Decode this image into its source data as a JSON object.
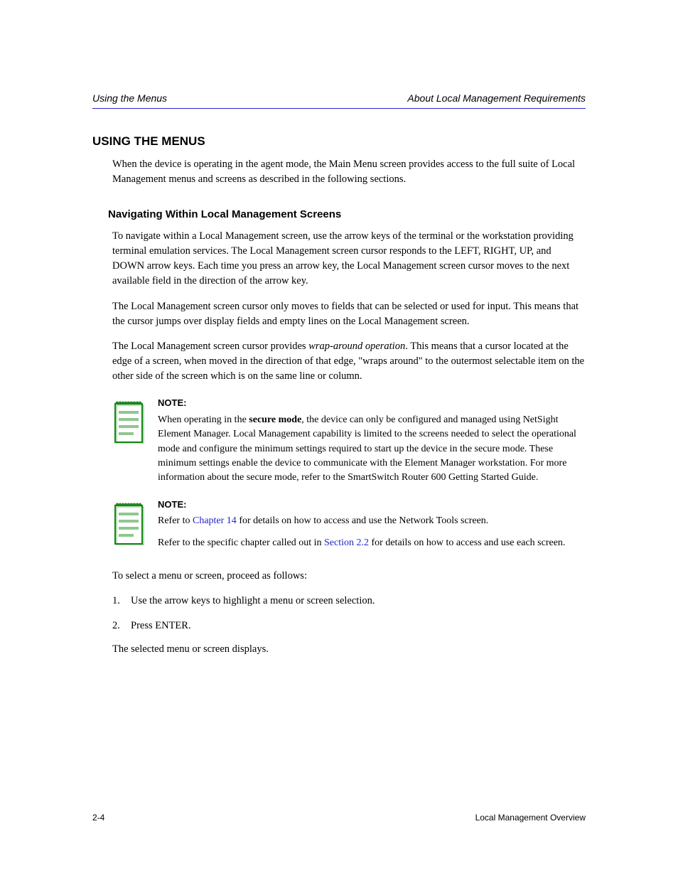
{
  "header": {
    "left": "Using the Menus",
    "right": "About Local Management Requirements"
  },
  "section_title": "USING THE MENUS",
  "intro_para": "When the device is operating in the agent mode, the Main Menu screen provides access to the full suite of Local Management menus and screens as described in the following sections.",
  "subsection_title": "Navigating Within Local Management Screens",
  "body1": "To navigate within a Local Management screen, use the arrow keys of the terminal or the workstation providing terminal emulation services. The Local Management screen cursor responds to the LEFT, RIGHT, UP, and DOWN arrow keys. Each time you press an arrow key, the Local Management screen cursor moves to the next available field in the direction of the arrow key.",
  "body2": "The Local Management screen cursor only moves to fields that can be selected or used for input. This means that the cursor jumps over display fields and empty lines on the Local Management screen.",
  "body3_prefix": "The Local Management screen cursor provides ",
  "body3_em": "wrap-around operation",
  "body3_suffix": ". This means that a cursor located at the edge of a screen, when moved in the direction of that edge, \"wraps around\" to the outermost selectable item on the other side of the screen which is on the same line or column.",
  "note1": {
    "heading": "NOTE:",
    "text_prefix": "When operating in the ",
    "text_bold": "secure mode",
    "text_suffix": ", the device can only be configured and managed using NetSight Element Manager. Local Management capability is limited to the screens needed to select the operational mode and configure the minimum settings required to start up the device in the secure mode. These minimum settings enable the device to communicate with the Element Manager workstation. For more information about the secure mode, refer to the SmartSwitch Router 600 Getting Started Guide."
  },
  "note2": {
    "heading": "NOTE:",
    "line1_prefix": "Refer to ",
    "line1_link": "Chapter 14",
    "line1_suffix": " for details on how to access and use the Network Tools screen.",
    "line2_prefix": "Refer to the specific chapter called out in ",
    "line2_link": "Section 2.2",
    "line2_suffix": " for details on how to access and use each screen."
  },
  "proc_intro": "To select a menu or screen, proceed as follows:",
  "step1": {
    "num": "1.",
    "text": "Use the arrow keys to highlight a menu or screen selection."
  },
  "step2": {
    "num": "2.",
    "text": "Press ENTER."
  },
  "closing": "The selected menu or screen displays.",
  "footer": {
    "left": "2-4",
    "right": "Local Management Overview"
  }
}
